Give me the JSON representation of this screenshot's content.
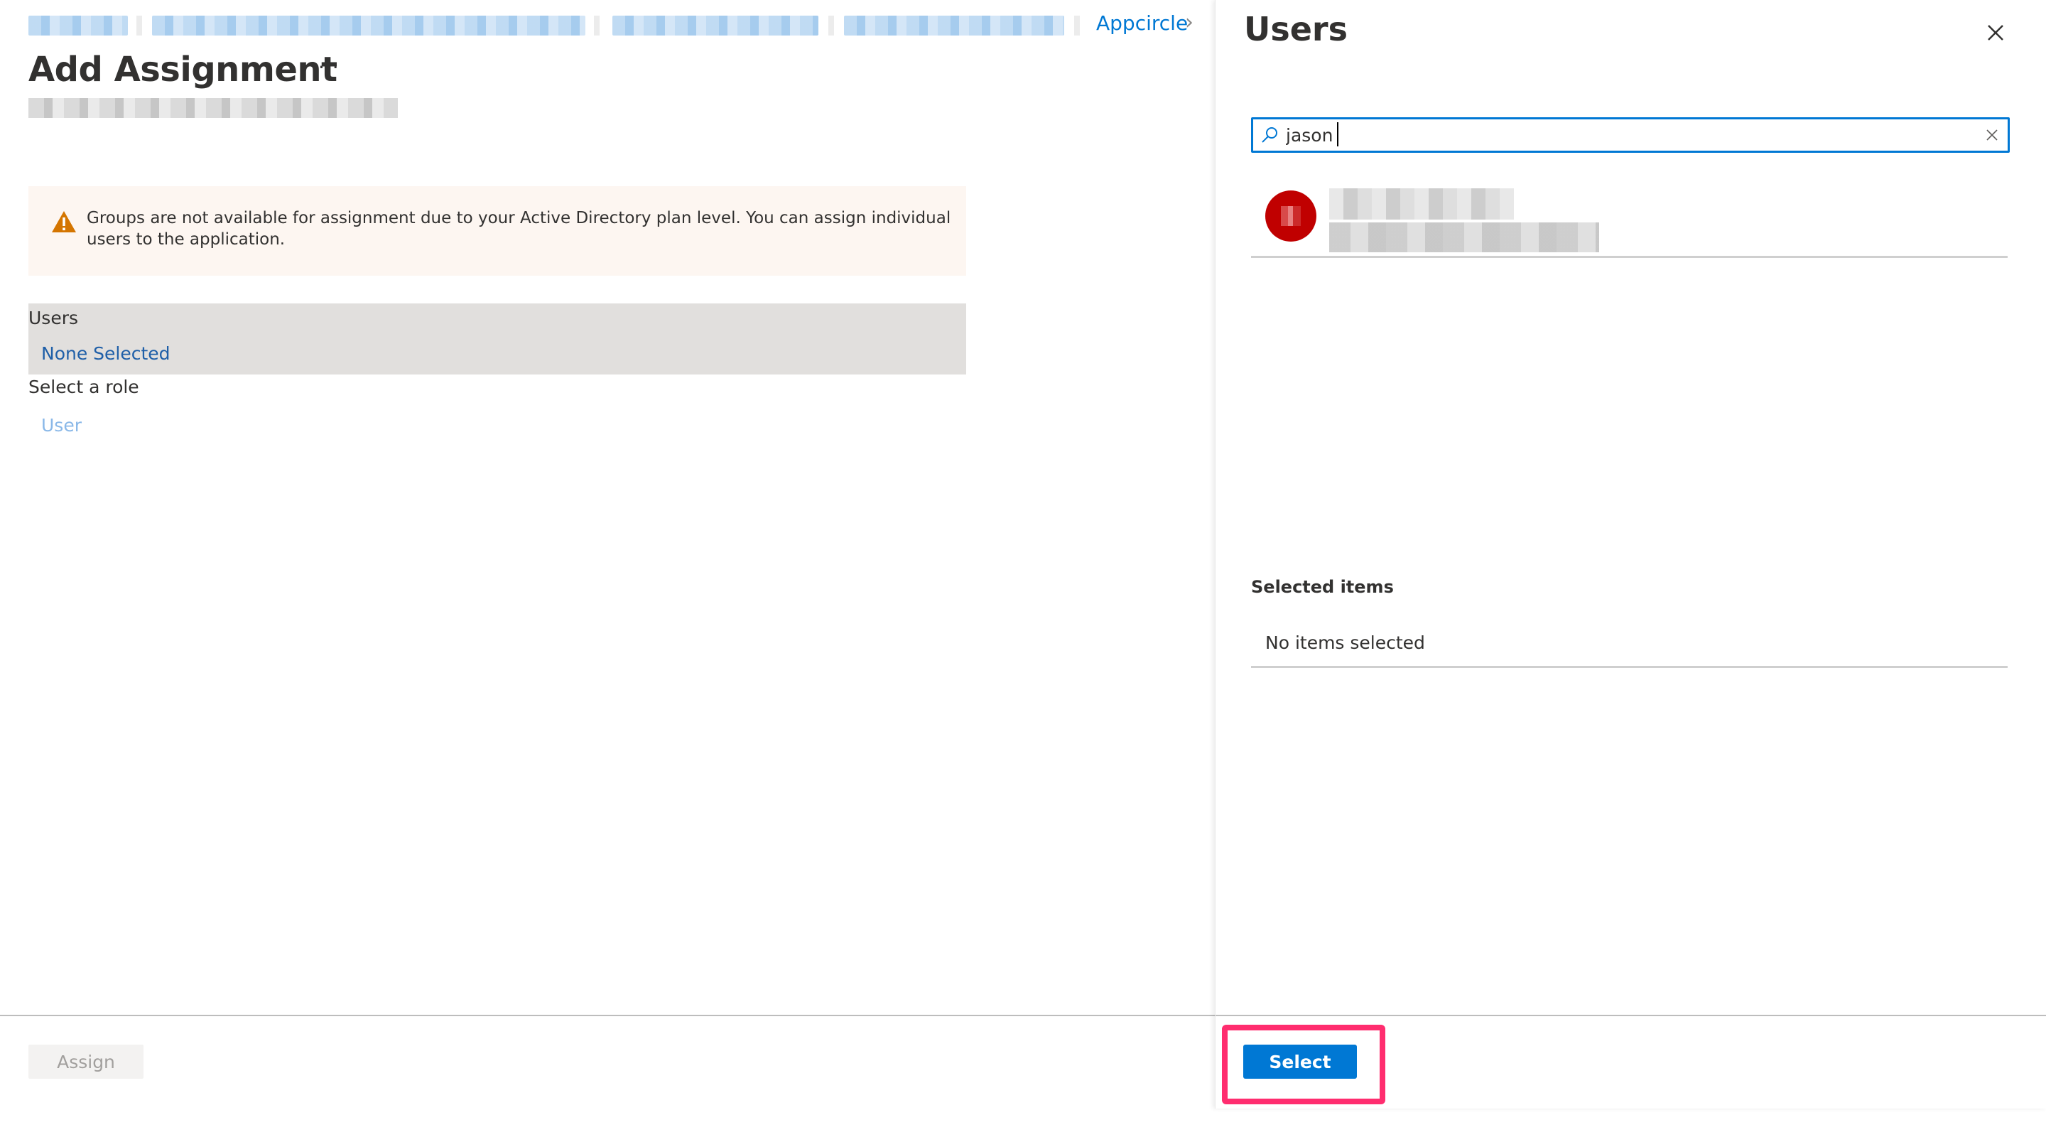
{
  "breadcrumb": {
    "items": [
      {
        "label": "[redacted]",
        "redacted": true
      },
      {
        "label": "[redacted]",
        "redacted": true
      },
      {
        "label": "[redacted]",
        "redacted": true
      },
      {
        "label": "[redacted]",
        "redacted": true
      },
      {
        "label": "Appcircle",
        "redacted": false
      }
    ],
    "separator": "›"
  },
  "page": {
    "title": "Add Assignment",
    "more_label": "···",
    "subtitle": "[redacted]"
  },
  "warning": {
    "icon": "warning-icon",
    "text": "Groups are not available for assignment due to your Active Directory plan level. You can assign individual users to the application."
  },
  "form": {
    "users_label": "Users",
    "users_value": "None Selected",
    "role_label": "Select a role",
    "role_value": "User"
  },
  "footer": {
    "assign_label": "Assign"
  },
  "panel": {
    "title": "Users",
    "close_icon": "close-icon",
    "search": {
      "value": "jason",
      "placeholder": "",
      "icon": "search-icon",
      "clear_icon": "clear-icon"
    },
    "results": [
      {
        "name": "[redacted]",
        "email": "[redacted]",
        "avatar_color": "#c00000"
      }
    ],
    "selected_title": "Selected items",
    "selected_empty": "No items selected",
    "select_label": "Select"
  },
  "colors": {
    "accent": "#0078d4",
    "link": "#1f5fa8",
    "warning_bg": "#fdf6f1",
    "warning_icon": "#d47500",
    "highlight": "#ff2d6f"
  }
}
